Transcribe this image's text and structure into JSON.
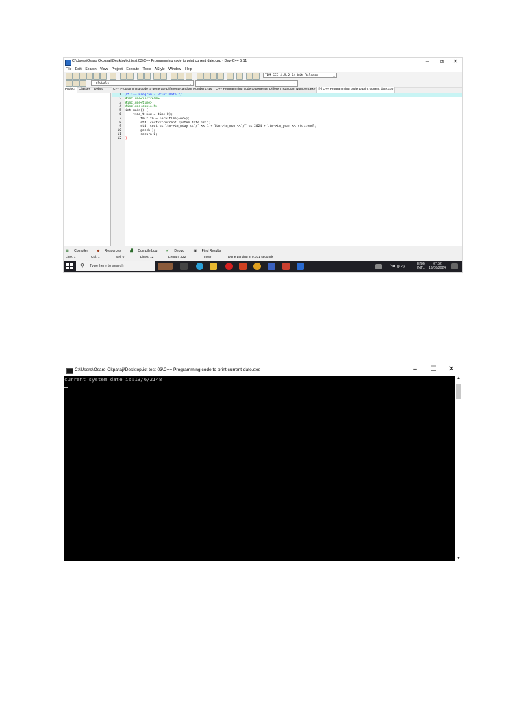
{
  "devcpp": {
    "title": "C:\\Users\\Osaro Okparaji\\Desktop\\ict test 03\\C++ Programming code to print current date.cpp - Dev-C++ 5.11",
    "window_controls": [
      "–",
      "⧉",
      "✕"
    ],
    "menu": [
      "File",
      "Edit",
      "Search",
      "View",
      "Project",
      "Execute",
      "Tools",
      "AStyle",
      "Window",
      "Help"
    ],
    "compiler": "TDM-GCC 4.9.2 64-bit Release",
    "globals": "(globals)",
    "project_tabs": [
      "Project",
      "Classes",
      "Debug"
    ],
    "file_tabs": [
      "C++ Programming code to generate Different Random Numbers.cpp",
      "C++ Programming code to generate Different Random Numbers.exe",
      "[*] C++ Programming code to print current date.cpp"
    ],
    "code_lines": [
      {
        "n": "1",
        "text": "/* C++ Program - Print Date */",
        "color": "#1c1cff"
      },
      {
        "n": "2",
        "text": "#include<iostream>",
        "color": "#008000"
      },
      {
        "n": "3",
        "text": "#include<time>",
        "color": "#008000"
      },
      {
        "n": "4",
        "text": "#include<conio.h>",
        "color": "#008000"
      },
      {
        "n": "5",
        "text": "int main() {",
        "color": "#000000"
      },
      {
        "n": "6",
        "text": "    time_t now = time(0);",
        "color": "#000000"
      },
      {
        "n": "7",
        "text": "        tm *ltm = localtime(&now);",
        "color": "#000000"
      },
      {
        "n": "8",
        "text": "        std::cout<<\"current system date is:\";",
        "color": "#000000"
      },
      {
        "n": "9",
        "text": "        std::cout << ltm->tm_mday <<\"/\" << 1 + ltm->tm_mon <<\"/\" << 2024 + ltm->tm_year << std::endl;",
        "color": "#000000"
      },
      {
        "n": "10",
        "text": "        getch();",
        "color": "#000000"
      },
      {
        "n": "11",
        "text": "        return 0;",
        "color": "#000000"
      },
      {
        "n": "12",
        "text": "}",
        "color": "#ff0000"
      }
    ],
    "message_tabs": [
      "Compiler",
      "Resources",
      "Compile Log",
      "Debug",
      "Find Results"
    ],
    "status": {
      "line": "Line: 1",
      "col": "Col: 1",
      "sel": "Sel: 0",
      "lines": "Lines: 12",
      "length": "Length: 322",
      "mode": "Insert",
      "message": "Done parsing in 0.031 seconds"
    },
    "taskbar": {
      "search_placeholder": "Type here to search",
      "lang": "ENG",
      "region": "INTL",
      "time": "07:52",
      "date": "13/06/2024"
    }
  },
  "console": {
    "title": "C:\\Users\\Osaro Okparaji\\Desktop\\ict test 03\\C++ Programming code to print current date.exe",
    "output": "current system date is:13/6/2148",
    "window_controls": [
      "–",
      "☐",
      "✕"
    ],
    "scroll_up": "▲",
    "scroll_down": "▼"
  }
}
